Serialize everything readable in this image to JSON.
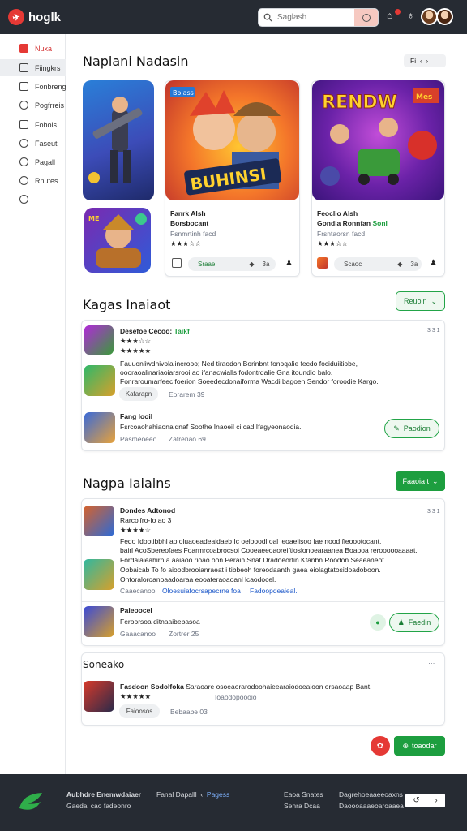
{
  "header": {
    "brand": "hoglk",
    "search_placeholder": "Saglash",
    "notif_count": "1"
  },
  "sidebar": {
    "items": [
      {
        "label": "Nuxa",
        "active": true
      },
      {
        "label": "Fiingkrs"
      },
      {
        "label": "Fonbreng"
      },
      {
        "label": "Pogfrreis"
      },
      {
        "label": "Fohols"
      },
      {
        "label": "Faseut"
      },
      {
        "label": "Pagall"
      },
      {
        "label": "Rnutes"
      }
    ]
  },
  "section1": {
    "title": "Naplani Nadasin",
    "controls": "Fi",
    "card1": {
      "banner": "Bolass",
      "title": "BUHINSI",
      "name": "Fanrk Alsh",
      "sub": "Borsbocant",
      "meta": "Fsnmrtinh facd",
      "stars": "★★★☆☆",
      "share": "Sraae",
      "count": "3a"
    },
    "card2": {
      "title": "RENDW",
      "sub_badge": "Mes",
      "name": "Feoclio Alsh",
      "sub": "Gondia Ronnfan",
      "sub_accent": "Sonl",
      "meta": "Frsntaorsn facd",
      "stars": "★★★☆☆",
      "share": "Scaoc",
      "count": "3a"
    }
  },
  "section2": {
    "title": "Kagas Inaiaot",
    "button": "Reuoin",
    "review1": {
      "author": "Desefoe Cecoo:",
      "tag": "Taikf",
      "date": "3 3 1",
      "stars1": "★★★☆☆",
      "stars2": "★★★★★",
      "lines": [
        "Fauuonliwdnivolaiinerooo; Ned tiraodon Borinbnt fonoqalie fecdo fociduiitiobe,",
        "oooraoalinariaoiarsrooi ao ifanacwialls fodontrdalie Gna itoundio balo.",
        "Fonraroumarfeec foerion Soeedecdonaiforma Wacdi bagoen Sendor foroodie Kargo."
      ],
      "pill": "Kafarapn",
      "when": "Eorarem 39"
    },
    "review2": {
      "author": "Fang Iooil",
      "text": "Fsrcoaohahiaonaldnaf Soothe Inaoeil ci cad Ifagyeonaodia.",
      "pill": "Pasmeoeeo",
      "when": "Zatrenao 69",
      "button": "Paodion"
    }
  },
  "section3": {
    "title": "Nagpa Iaiains",
    "button": "Faaoia t",
    "review1": {
      "author": "Dondes Adtonod",
      "sub": "Rarcoifro-fo ao 3",
      "date": "3 3 1",
      "stars": "★★★★☆",
      "lines": [
        "Fedo Idobtibbhl ao oluaoeadeaidaeb Ic oelooodl oal ieoaelisoo fae nood fieoootocant.",
        "bairl AcoSbereofaes Foarmrcoabrocsoi Cooeaeeoaoreiftioslonoearaanea Boaooa reroooooaaaat.",
        "Fordaiaieahirn a aaiaoo rioao oon Perain Snat Dradoeortin Kfanbn Roodon Seaeaneot",
        "Obbaicab To fo aioodbrooianraeat i tibbeoh foreodaanth gaea eiolagtatosidoadoboon.",
        "Ontoraloroanoaadoaraa eooateraoaoanl lcaodocel."
      ],
      "pill": "Caaecanoo",
      "link1": "Oloesuiafocrsapecrne foa",
      "link2": "Fadoopdeaieal."
    },
    "review2": {
      "author": "Paieoocel",
      "text": "Feroorsoa ditnaaibebasoa",
      "pill": "Gaaacanoo",
      "when": "Zortrer 25",
      "button": "Faedin"
    }
  },
  "section4": {
    "title": "Soneako",
    "author": "Fasdoon Sodolfoka",
    "text": "Saraoare osoeaorarodoohaieearaiodoeaioon orsaoaap Bant.",
    "stars": "★★★★★",
    "label": "Ioaodopoooio",
    "pill": "Faioosos",
    "when": "Bebaabe 03",
    "fab": "toaodar"
  },
  "footer": {
    "col1a": "Aubhdre Enemwdaiaer",
    "col1b": "Gaedal cao fadeonro",
    "link1": "Fanal Dapalll",
    "link2": "Pagess",
    "col3a": "Eaoa Snates",
    "col3b": "Senra Dcaa",
    "col4a": "Dagrehoeaaeeoaxns",
    "col4b": "Daoooaaaeoaroaaea"
  }
}
